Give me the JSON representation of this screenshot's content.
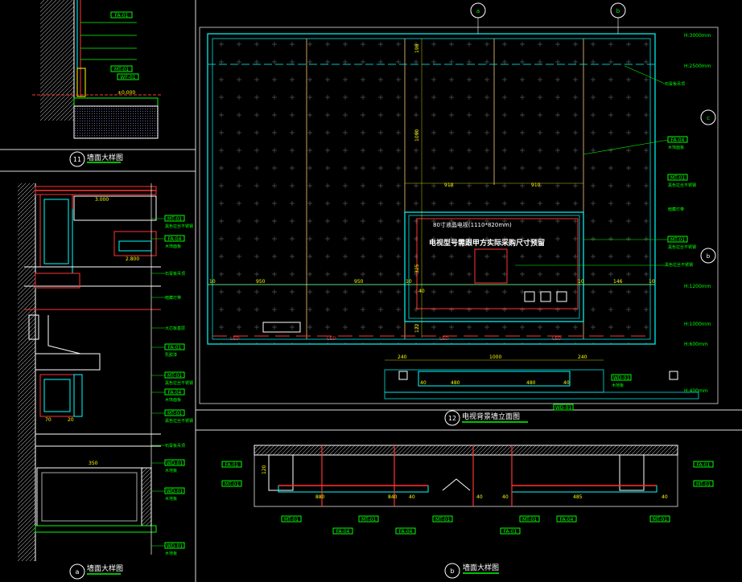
{
  "detail11": {
    "title": "墙面大样图",
    "number": "11",
    "tags": [
      "FA-01",
      "MT-01",
      "WF-01"
    ],
    "level": "±0.000"
  },
  "elev12": {
    "title": "电视背景墙立面图",
    "number": "12",
    "tv_note": "电视型号需跟甲方实际采购尺寸预留",
    "tv_size": "80寸液晶电视(1110*820mm)",
    "markers": {
      "top_left": "a",
      "top_right": "b",
      "right_upper": "c",
      "right_lower": "b"
    },
    "heights": [
      "H:3000mm",
      "H:2500mm",
      "H:1200mm",
      "H:1000mm",
      "H:600mm",
      "H:400mm"
    ],
    "right_tags": [
      {
        "code": "FA-04",
        "desc": "木饰面板"
      },
      {
        "code": "MT-01",
        "desc": "黑色拉丝不锈钢"
      },
      {
        "code": "MT-01",
        "desc": "黑色拉丝不锈钢"
      },
      {
        "code": "MT-01",
        "desc": "黑色拉丝不锈钢"
      }
    ],
    "right_notes": [
      "石膏板吊顶",
      "暗藏灯带"
    ],
    "bottom_tag": {
      "code": "WD-01",
      "desc": "木地板"
    },
    "bottom_tag2": {
      "code": "WD-01"
    },
    "dims_h": [
      "10",
      "950",
      "950",
      "10",
      "40",
      "10",
      "146",
      "10"
    ],
    "dims_top": [
      "910",
      "910"
    ],
    "dims_v": [
      "198",
      "1090",
      "325",
      "122"
    ],
    "dims_base": [
      "240",
      "1000",
      "240"
    ],
    "dims_base2": [
      "40",
      "480",
      "480",
      "40"
    ],
    "led": "LED"
  },
  "detailA": {
    "title": "墙面大样图",
    "marker": "a",
    "levels": [
      "3.000",
      "2.800"
    ],
    "tags": [
      {
        "code": "MT-01",
        "desc": "黑色拉丝不锈钢"
      },
      {
        "code": "FA-04",
        "desc": "木饰面板"
      },
      {
        "code": "FA-01",
        "desc": "乳胶漆"
      },
      {
        "code": "MT-01",
        "desc": "黑色拉丝不锈钢"
      },
      {
        "code": "FA-04",
        "desc": "木饰面板"
      },
      {
        "code": "MT-01",
        "desc": "黑色拉丝不锈钢"
      },
      {
        "code": "WD-01",
        "desc": "木地板"
      },
      {
        "code": "WD-01",
        "desc": "木地板"
      },
      {
        "code": "WD-01",
        "desc": "木地板"
      }
    ],
    "notes": [
      "石膏板吊顶",
      "暗藏灯带",
      "大芯板基层",
      "石膏板吊顶"
    ],
    "dims": [
      "350",
      "70",
      "20",
      "100",
      "160"
    ]
  },
  "detailB": {
    "title": "墙面大样图",
    "marker": "b",
    "tags_left": [
      "FA-01",
      "MT-01"
    ],
    "tags_right": [
      "FA-01",
      "MT-01"
    ],
    "bottom_tags": [
      "MT-01",
      "FA-04",
      "MT-01",
      "FA-04",
      "MT-01",
      "FA-01",
      "MT-01",
      "FA-04",
      "MT-01"
    ],
    "dims": [
      "120",
      "880",
      "40",
      "840",
      "40",
      "40",
      "485",
      "40"
    ]
  }
}
